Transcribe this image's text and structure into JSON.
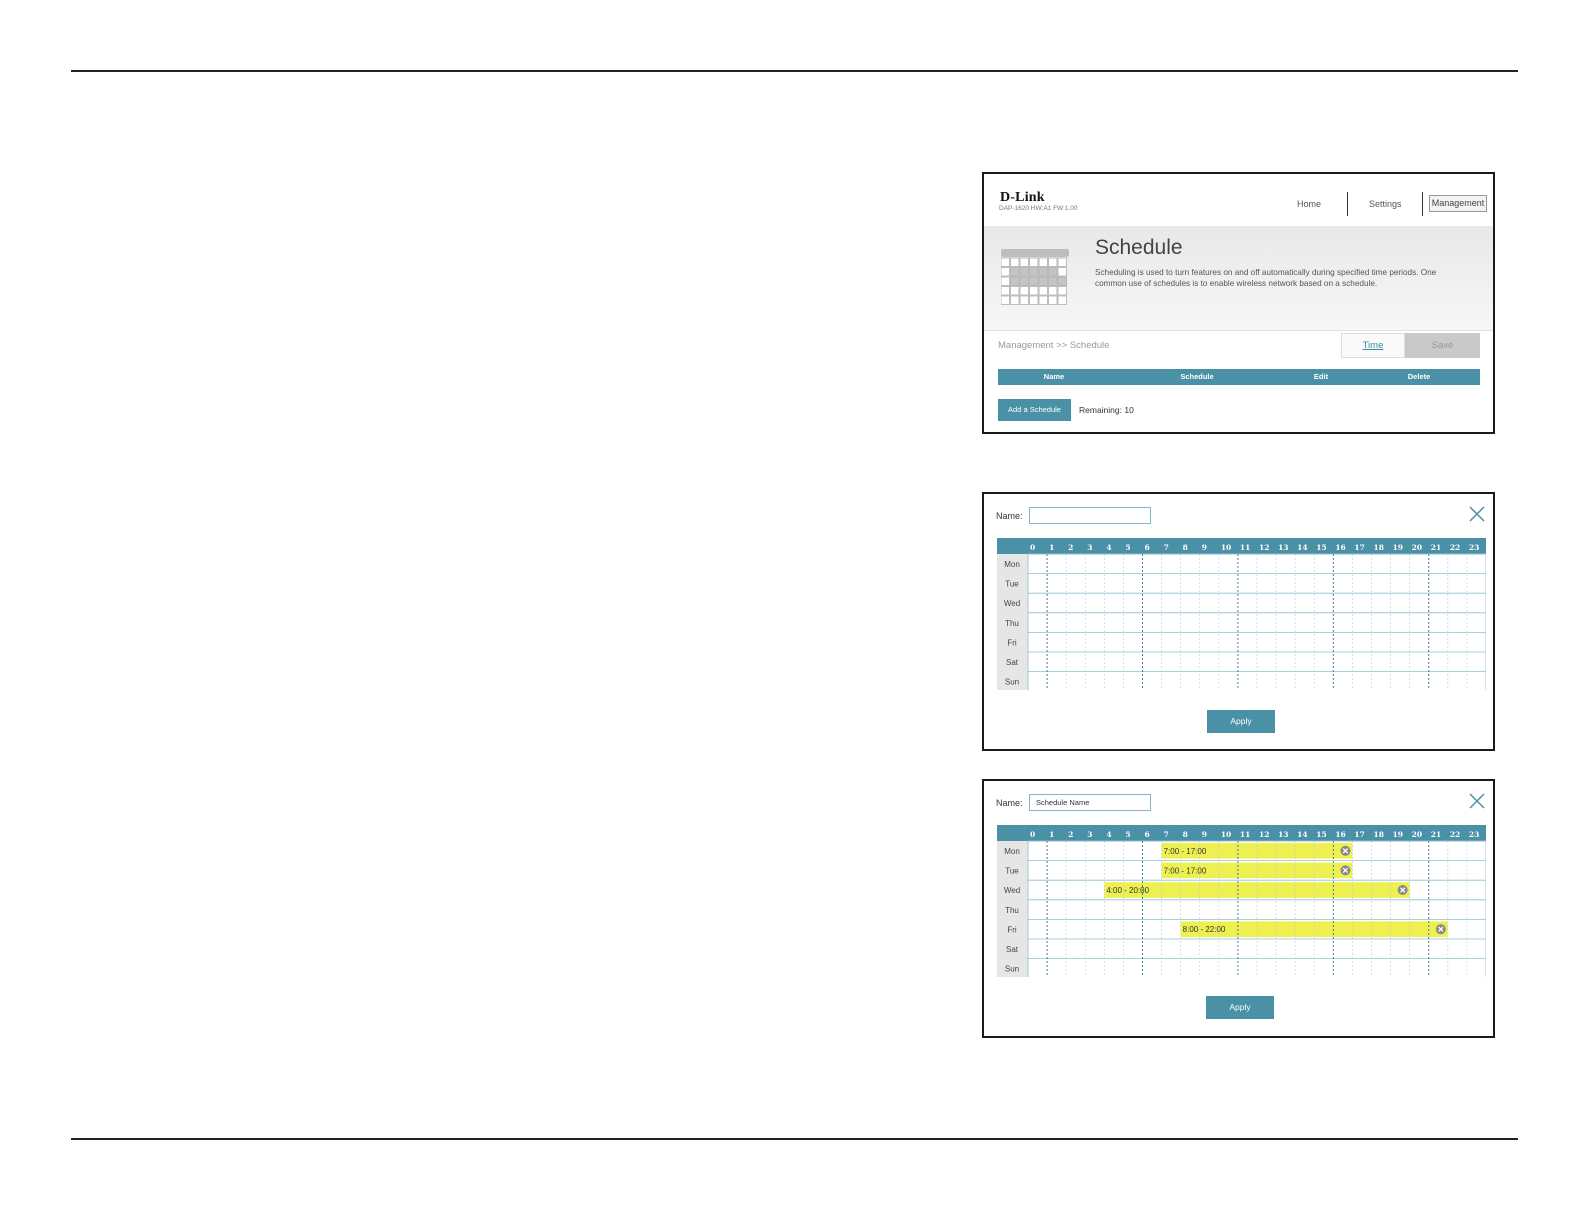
{
  "header": {
    "logo": "D-Link",
    "firmware": "DAP-1620 HW:A1 FW:1.00",
    "nav": [
      "Home",
      "Settings",
      "Management"
    ],
    "active_nav": "Management"
  },
  "schedule_page": {
    "title": "Schedule",
    "description": "Scheduling is used to turn features on and off automatically during specified time periods. One common use of schedules is to enable wireless network based on a schedule.",
    "breadcrumb": "Management >> Schedule",
    "time_link": "Time",
    "save_label": "Save",
    "table_headers": [
      "Name",
      "Schedule",
      "Edit",
      "Delete"
    ],
    "add_button": "Add a Schedule",
    "remaining": "Remaining: 10"
  },
  "editor_empty": {
    "name_label": "Name:",
    "name_value": "",
    "apply_label": "Apply"
  },
  "editor_filled": {
    "name_label": "Name:",
    "name_value": "Schedule Name",
    "apply_label": "Apply"
  },
  "grid": {
    "hours": [
      "0",
      "1",
      "2",
      "3",
      "4",
      "5",
      "6",
      "7",
      "8",
      "9",
      "10",
      "11",
      "12",
      "13",
      "14",
      "15",
      "16",
      "17",
      "18",
      "19",
      "20",
      "21",
      "22",
      "23"
    ],
    "days": [
      "Mon",
      "Tue",
      "Wed",
      "Thu",
      "Fri",
      "Sat",
      "Sun"
    ]
  },
  "schedule_entries": [
    {
      "day": "Mon",
      "start": 7,
      "end": 17,
      "label": "7:00 - 17:00"
    },
    {
      "day": "Tue",
      "start": 7,
      "end": 17,
      "label": "7:00 - 17:00"
    },
    {
      "day": "Wed",
      "start": 4,
      "end": 20,
      "label": "4:00 - 20:00"
    },
    {
      "day": "Fri",
      "start": 8,
      "end": 22,
      "label": "8:00 - 22:00"
    }
  ],
  "colors": {
    "accent": "#4a90a6",
    "highlight": "#eef050",
    "day_cell": "#e6e6e6"
  },
  "icons": [
    "calendar-icon",
    "close-icon",
    "remove-entry-icon"
  ]
}
